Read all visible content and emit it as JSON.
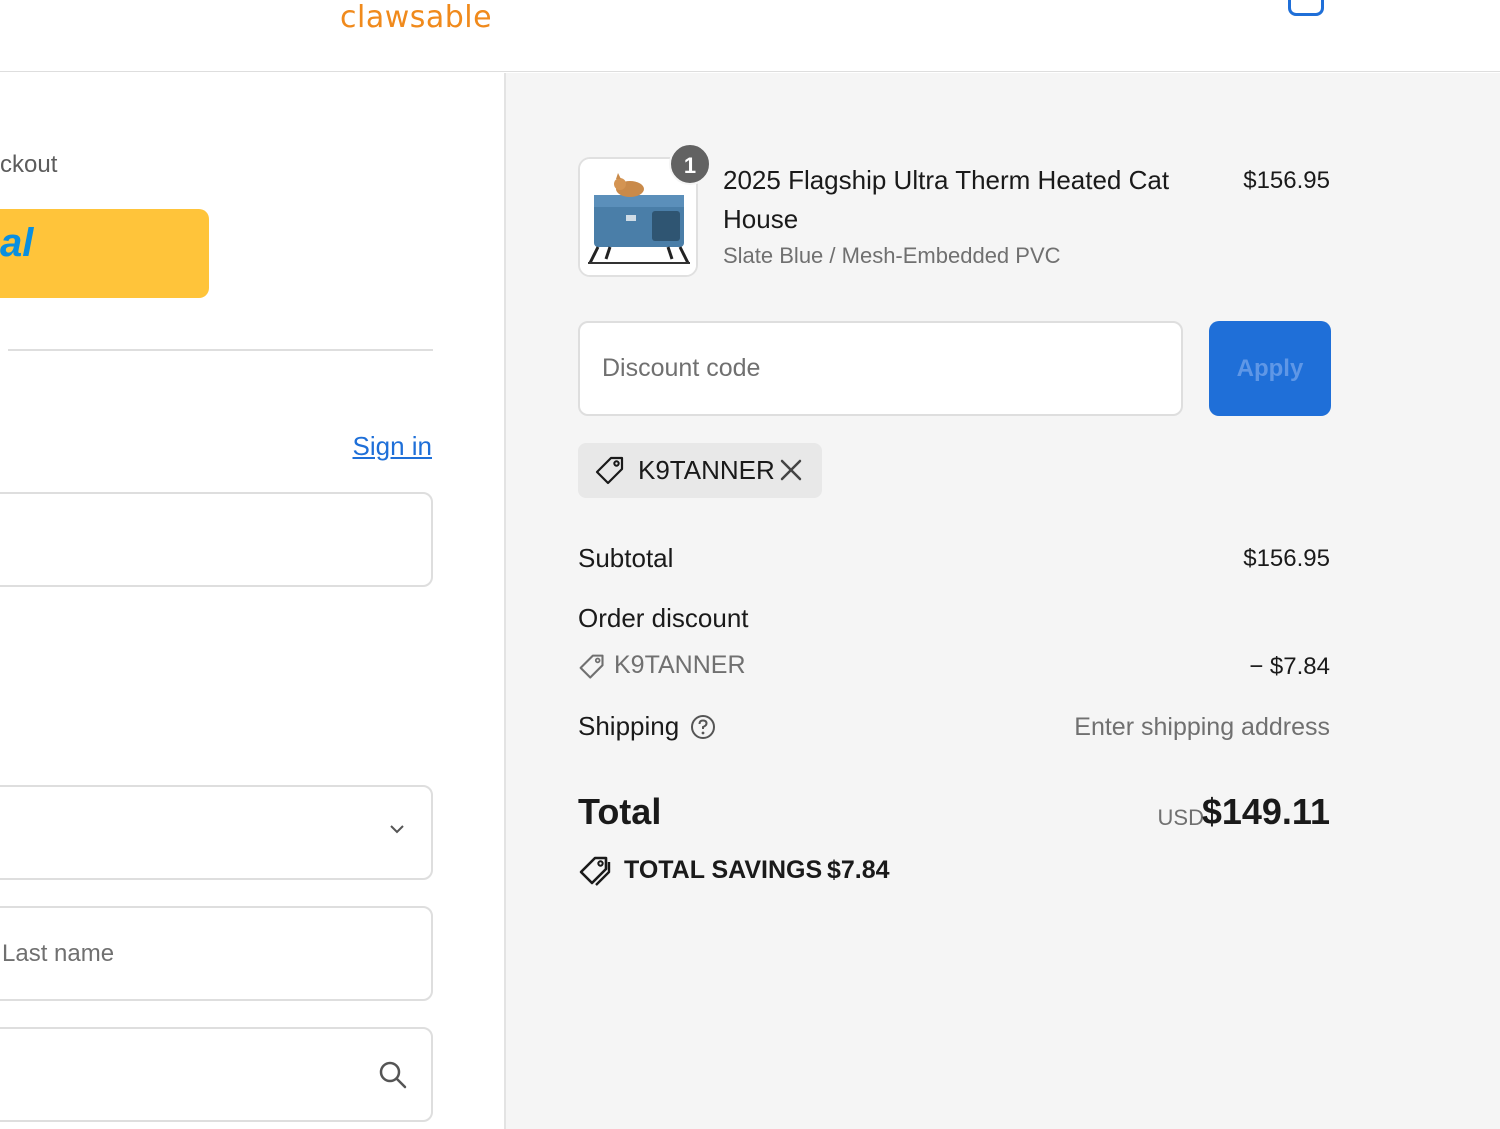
{
  "header": {
    "logo_text": "clawsable",
    "cart_icon": "bag-icon",
    "accent_color": "#1f6fd8",
    "logo_color": "#f08a1c"
  },
  "left": {
    "express_checkout_label": "ckout",
    "paypal_label": "al",
    "signin_label": "Sign in",
    "last_name_placeholder": "Last name"
  },
  "order": {
    "item": {
      "quantity": "1",
      "title": "2025 Flagship Ultra Therm Heated Cat House",
      "variant": "Slate Blue / Mesh-Embedded PVC",
      "price": "$156.95"
    },
    "discount": {
      "placeholder": "Discount code",
      "apply_label": "Apply",
      "applied_code": "K9TANNER"
    },
    "summary": {
      "subtotal_label": "Subtotal",
      "subtotal_value": "$156.95",
      "order_discount_label": "Order discount",
      "order_discount_code": "K9TANNER",
      "order_discount_value": "− $7.84",
      "shipping_label": "Shipping",
      "shipping_value": "Enter shipping address",
      "total_label": "Total",
      "currency": "USD",
      "total_value": "$149.11",
      "savings_label": "TOTAL SAVINGS",
      "savings_value": "$7.84"
    }
  }
}
